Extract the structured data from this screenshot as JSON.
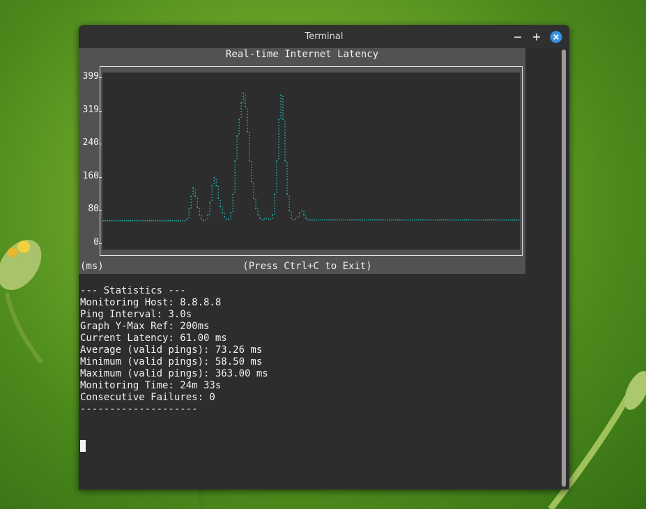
{
  "window": {
    "title": "Terminal"
  },
  "chart": {
    "title": "Real-time Internet Latency",
    "unit_label": "(ms)",
    "exit_hint": "(Press Ctrl+C to Exit)",
    "y_ticks": [
      "399",
      "319",
      "240",
      "160",
      "80",
      "0"
    ],
    "colors": {
      "panel": "#525252",
      "plot": "#2d2d2d",
      "series": "#20b2aa"
    }
  },
  "chart_data": {
    "type": "line",
    "ylim": [
      0,
      399
    ],
    "y_ticks": [
      0,
      80,
      160,
      240,
      319,
      399
    ],
    "grid": false,
    "series": [
      {
        "values": [
          56,
          56,
          56,
          56,
          56,
          56,
          56,
          56,
          56,
          56,
          56,
          56,
          56,
          56,
          56,
          56,
          56,
          56,
          56,
          56,
          56,
          56,
          56,
          56,
          56,
          56,
          56,
          56,
          56,
          56,
          56,
          56,
          56,
          56,
          56,
          56,
          56,
          56,
          56,
          56,
          60,
          85,
          115,
          135,
          115,
          88,
          70,
          60,
          56,
          58,
          70,
          100,
          140,
          160,
          140,
          110,
          90,
          75,
          65,
          60,
          60,
          75,
          120,
          200,
          260,
          300,
          340,
          363,
          330,
          270,
          200,
          150,
          110,
          85,
          70,
          62,
          58,
          60,
          62,
          60,
          60,
          70,
          120,
          200,
          300,
          358,
          300,
          200,
          120,
          80,
          62,
          58,
          60,
          65,
          75,
          80,
          70,
          62,
          58,
          58,
          58,
          58,
          58,
          58,
          58,
          58,
          58,
          58,
          58,
          58,
          58,
          58,
          58,
          58,
          58,
          58,
          58,
          58,
          58,
          58,
          58,
          58,
          58,
          58,
          58,
          58,
          58,
          58,
          58,
          58,
          58,
          58,
          58,
          58,
          58,
          58,
          58,
          58,
          58,
          58,
          58,
          58,
          58,
          58,
          58,
          58,
          58,
          58,
          58,
          58,
          58,
          58,
          58,
          58,
          58,
          58,
          58,
          58,
          58,
          58,
          58,
          58,
          58,
          58,
          58,
          58,
          58,
          58,
          58,
          58,
          58,
          58,
          58,
          58,
          58,
          58,
          58,
          58,
          58,
          58,
          58,
          58,
          58,
          58,
          58,
          58,
          58,
          58,
          58,
          58,
          58,
          58,
          58,
          58,
          58,
          58,
          58,
          58,
          58,
          58
        ]
      }
    ]
  },
  "stats": {
    "header": "--- Statistics ---",
    "host": "Monitoring Host: 8.8.8.8",
    "interval": "Ping Interval: 3.0s",
    "ymax": "Graph Y-Max Ref: 200ms",
    "current": "Current Latency: 61.00 ms",
    "average": "Average (valid pings): 73.26 ms",
    "minimum": "Minimum (valid pings): 58.50 ms",
    "maximum": "Maximum (valid pings): 363.00 ms",
    "time": "Monitoring Time: 24m 33s",
    "failures": "Consecutive Failures: 0",
    "divider": "--------------------"
  }
}
